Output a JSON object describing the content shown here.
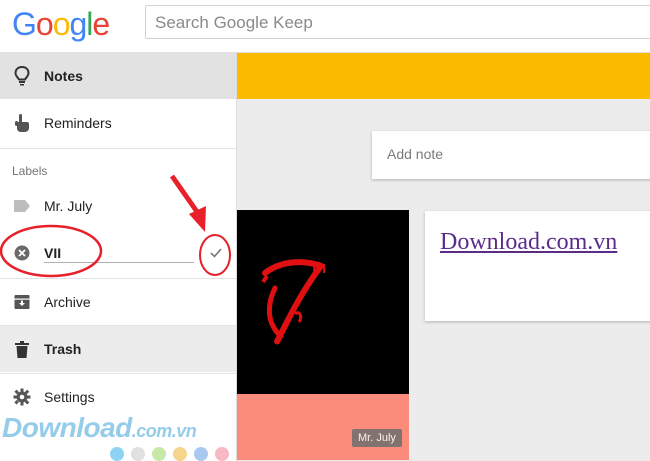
{
  "header": {
    "logo_letters": [
      "G",
      "o",
      "o",
      "g",
      "l",
      "e"
    ],
    "logo_colors": [
      "#4285F4",
      "#EA4335",
      "#FBBC05",
      "#4285F4",
      "#34A853",
      "#EA4335"
    ],
    "search_placeholder": "Search Google Keep"
  },
  "sidebar": {
    "notes_label": "Notes",
    "reminders_label": "Reminders",
    "labels_heading": "Labels",
    "label_items": [
      "Mr. July",
      "VII"
    ],
    "archive_label": "Archive",
    "trash_label": "Trash",
    "settings_label": "Settings"
  },
  "main": {
    "banner_color": "#FDBB00",
    "add_note_placeholder": "Add note",
    "image_note": {
      "superscript": "th",
      "chip_label": "Mr. July"
    },
    "link_note": {
      "text": "Download.com.vn"
    }
  },
  "watermark": {
    "main": "Download",
    "suffix": ".com.vn"
  },
  "annotations": {
    "color": "#E8202A",
    "dot_colors": [
      "#8fd3f4",
      "#e0e0e0",
      "#c6e8a8",
      "#f4d58d",
      "#a9c9f0",
      "#f7b8c4"
    ]
  }
}
